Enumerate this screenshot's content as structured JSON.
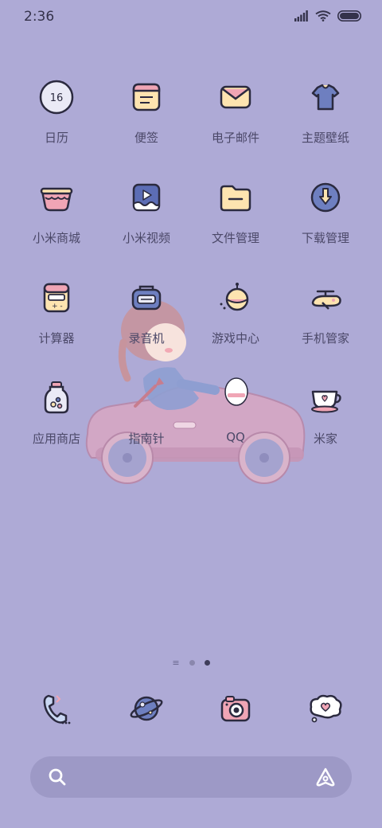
{
  "status_bar": {
    "time": "2:36"
  },
  "apps": [
    {
      "label": "日历",
      "icon": "calendar-icon",
      "badge": "16"
    },
    {
      "label": "便签",
      "icon": "notes-icon"
    },
    {
      "label": "电子邮件",
      "icon": "mail-icon"
    },
    {
      "label": "主题壁纸",
      "icon": "themes-icon"
    },
    {
      "label": "小米商城",
      "icon": "shop-icon"
    },
    {
      "label": "小米视频",
      "icon": "video-icon"
    },
    {
      "label": "文件管理",
      "icon": "file-manager-icon"
    },
    {
      "label": "下载管理",
      "icon": "download-icon"
    },
    {
      "label": "计算器",
      "icon": "calculator-icon"
    },
    {
      "label": "录音机",
      "icon": "recorder-icon"
    },
    {
      "label": "游戏中心",
      "icon": "game-center-icon"
    },
    {
      "label": "手机管家",
      "icon": "security-icon"
    },
    {
      "label": "应用商店",
      "icon": "app-store-icon"
    },
    {
      "label": "指南针",
      "icon": "compass-icon"
    },
    {
      "label": "QQ",
      "icon": "qq-icon"
    },
    {
      "label": "米家",
      "icon": "mijia-icon"
    }
  ],
  "page_indicator": {
    "pages": 2,
    "active": 2
  },
  "dock": [
    {
      "icon": "phone-icon"
    },
    {
      "icon": "browser-planet-icon"
    },
    {
      "icon": "camera-icon"
    },
    {
      "icon": "messages-icon"
    }
  ],
  "colors": {
    "background": "#aeaad6",
    "icon_stroke": "#2b2a3f",
    "pink": "#f0a5b5",
    "cream": "#fde4b0",
    "blue": "#6e7fc0"
  }
}
